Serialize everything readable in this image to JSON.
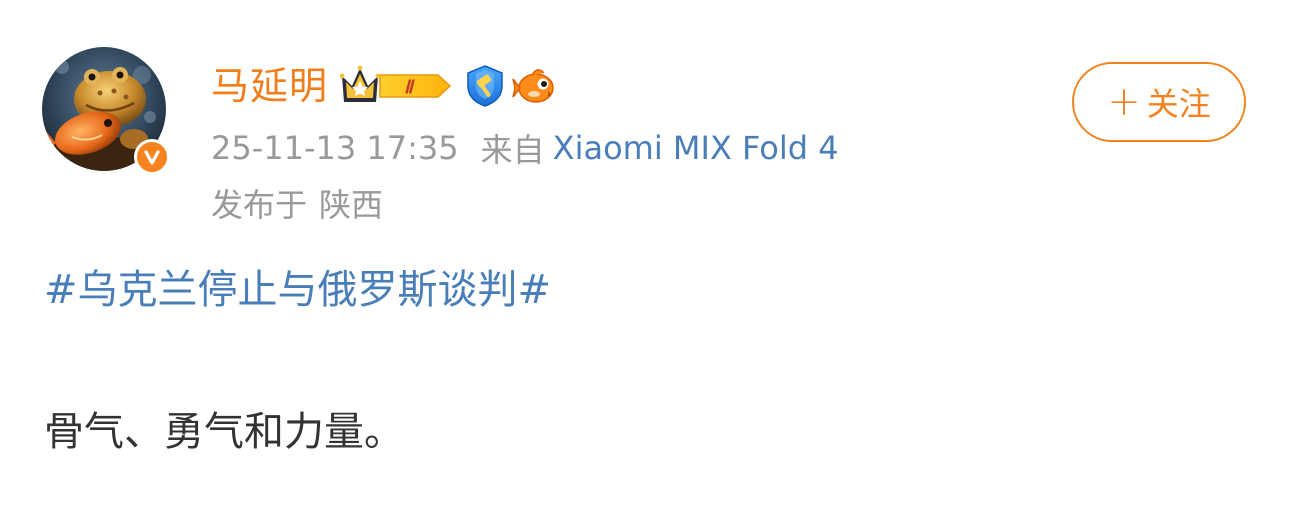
{
  "post": {
    "author": {
      "name": "马延明",
      "avatar_icon": "golden-toad-avatar",
      "verified_icon": "verified-v-icon",
      "badges": [
        "vip-crown-icon",
        "shield-hammer-icon",
        "orange-fish-icon"
      ],
      "vip_level": "Ⅱ"
    },
    "meta": {
      "timestamp": "25-11-13 17:35",
      "from_label": "来自",
      "device": "Xiaomi MIX Fold 4",
      "location_label": "发布于",
      "location": "陕西"
    },
    "follow_button": {
      "plus": "+",
      "label": "关注"
    },
    "topic": "#乌克兰停止与俄罗斯谈判#",
    "content": "骨气、勇气和力量。"
  },
  "colors": {
    "username": "#f27d1b",
    "link": "#4a7eb8",
    "meta": "#999999",
    "body_text": "#333333",
    "follow": "#f38220",
    "verified": "#f6831f"
  }
}
